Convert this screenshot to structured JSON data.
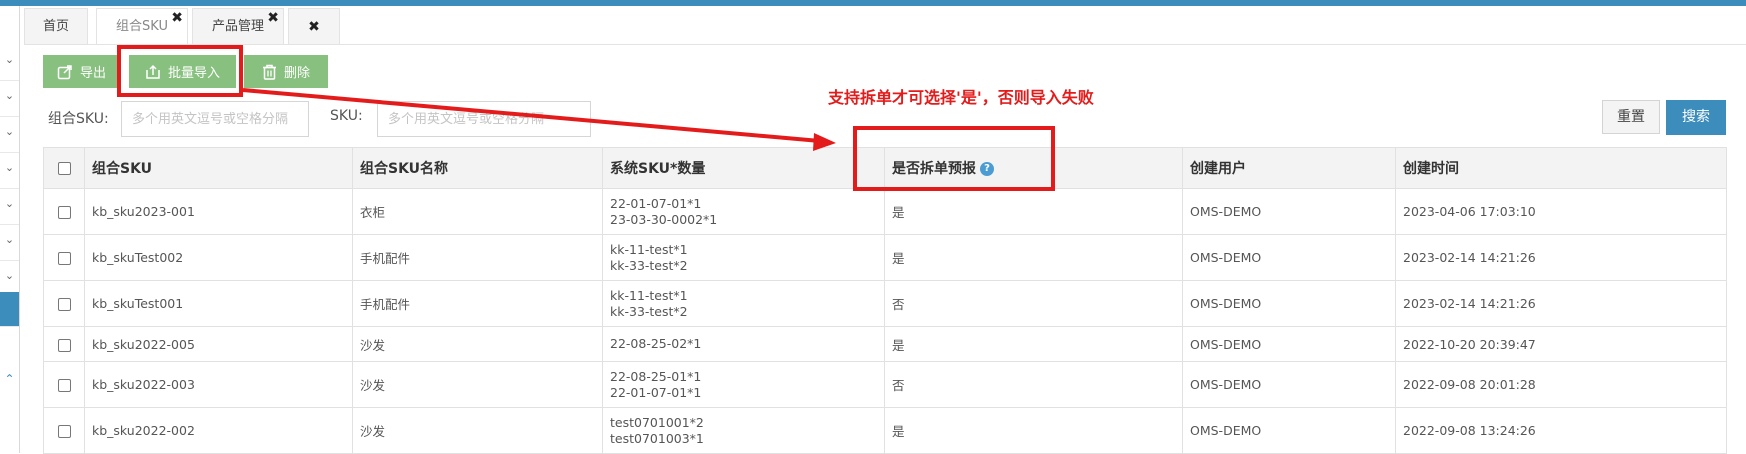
{
  "tabs": [
    {
      "label": "首页",
      "closable": false
    },
    {
      "label": "组合SKU",
      "closable": true
    },
    {
      "label": "产品管理",
      "closable": true
    },
    {
      "label": "",
      "closable": true
    }
  ],
  "toolbar": {
    "export_label": "导出",
    "batch_import_label": "批量导入",
    "delete_label": "删除"
  },
  "filters": {
    "combo_sku_label": "组合SKU:",
    "combo_sku_placeholder": "多个用英文逗号或空格分隔",
    "sku_label": "SKU:",
    "sku_placeholder": "多个用英文逗号或空格分隔"
  },
  "actions": {
    "reset_label": "重置",
    "search_label": "搜索"
  },
  "annotation": {
    "text": "支持拆单才可选择'是'，否则导入失败"
  },
  "table": {
    "columns": [
      "组合SKU",
      "组合SKU名称",
      "系统SKU*数量",
      "是否拆单预报",
      "创建用户",
      "创建时间"
    ],
    "rows": [
      {
        "combo_sku": "kb_sku2023-001",
        "name": "衣柜",
        "sku_qty": [
          "22-01-07-01*1",
          "23-03-30-0002*1"
        ],
        "split": "是",
        "user": "OMS-DEMO",
        "created": "2023-04-06 17:03:10"
      },
      {
        "combo_sku": "kb_skuTest002",
        "name": "手机配件",
        "sku_qty": [
          "kk-11-test*1",
          "kk-33-test*2"
        ],
        "split": "是",
        "user": "OMS-DEMO",
        "created": "2023-02-14 14:21:26"
      },
      {
        "combo_sku": "kb_skuTest001",
        "name": "手机配件",
        "sku_qty": [
          "kk-11-test*1",
          "kk-33-test*2"
        ],
        "split": "否",
        "user": "OMS-DEMO",
        "created": "2023-02-14 14:21:26"
      },
      {
        "combo_sku": "kb_sku2022-005",
        "name": "沙发",
        "sku_qty": [
          "22-08-25-02*1"
        ],
        "split": "是",
        "user": "OMS-DEMO",
        "created": "2022-10-20 20:39:47"
      },
      {
        "combo_sku": "kb_sku2022-003",
        "name": "沙发",
        "sku_qty": [
          "22-08-25-01*1",
          "22-01-07-01*1"
        ],
        "split": "否",
        "user": "OMS-DEMO",
        "created": "2022-09-08 20:01:28"
      },
      {
        "combo_sku": "kb_sku2022-002",
        "name": "沙发",
        "sku_qty": [
          "test0701001*2",
          "test0701003*1"
        ],
        "split": "是",
        "user": "OMS-DEMO",
        "created": "2022-09-08 13:24:26"
      }
    ]
  },
  "colors": {
    "accent_blue": "#3c8dbc",
    "button_green": "#88c07f",
    "highlight_red": "#e41b1b"
  }
}
